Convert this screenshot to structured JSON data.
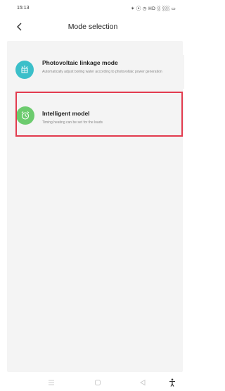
{
  "status_bar": {
    "time": "15:13",
    "icons_text": "✶ ⓐ ◷ HD ░ ░░ ▭"
  },
  "header": {
    "title": "Mode selection"
  },
  "modes": [
    {
      "title": "Photovoltaic linkage mode",
      "description": "Automatically adjust boiling water according to photovoltaic power generation",
      "icon": "solar-icon",
      "color": "#3bbfc9"
    },
    {
      "title": "Intelligent model",
      "description": "Timing heating can be set for the loads",
      "icon": "alarm-clock-icon",
      "color": "#6ccb6e"
    }
  ],
  "highlight_color": "#e23b4e",
  "nav_bar": {
    "icons": [
      "menu-icon",
      "home-icon",
      "back-triangle-icon",
      "accessibility-icon"
    ]
  }
}
